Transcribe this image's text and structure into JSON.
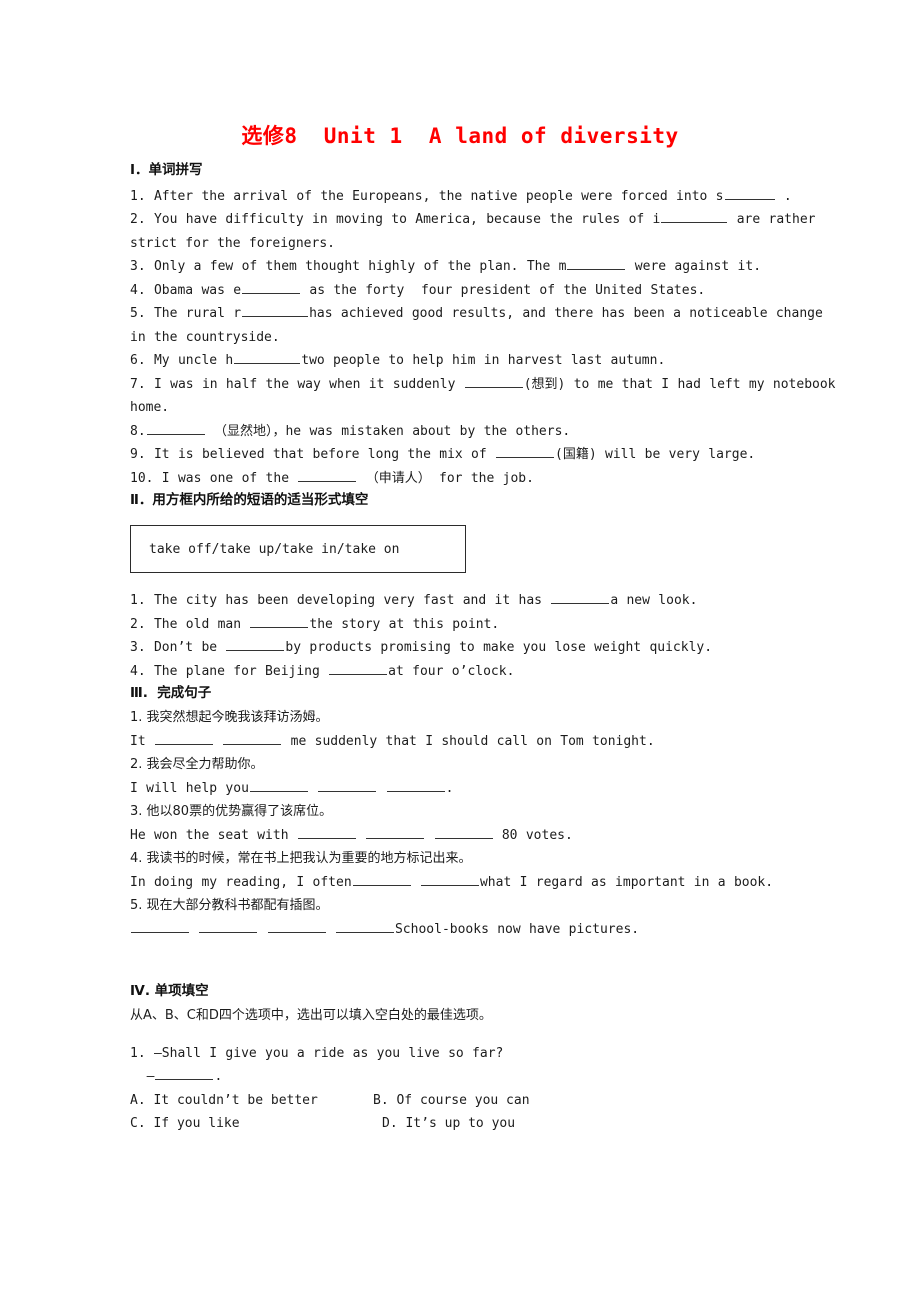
{
  "title": "选修8  Unit 1  A land of diversity",
  "sections": {
    "one": {
      "heading": "Ⅰ．单词拼写",
      "items": [
        {
          "pre": "1. After the arrival of the Europeans, the native people were forced into s",
          "blank": "b-sm",
          "post": " ."
        },
        {
          "pre": "2. You have difficulty in moving to America, because the rules of i",
          "blank": "b-lg",
          "post": " are rather"
        },
        {
          "cont": "strict for the foreigners."
        },
        {
          "pre": "3. Only a few of them thought highly of the plan. The m",
          "blank": "b-md",
          "post": " were against it."
        },
        {
          "pre": "4. Obama was e",
          "blank": "b-md",
          "post": " as the forty  four president of the United States."
        },
        {
          "pre": "5. The rural r",
          "blank": "b-lg",
          "post": "has achieved good results, and there has been a noticeable change"
        },
        {
          "cont": "in the countryside."
        },
        {
          "pre": "6. My uncle h",
          "blank": "b-lg",
          "post": "two people to help him in harvest last autumn."
        },
        {
          "pre": "7. I was in half the way when it suddenly ",
          "blank": "b-md",
          "post": "(想到) to me that I had left my notebook"
        },
        {
          "cont": "home."
        },
        {
          "pre": "8.",
          "blank": "b-md",
          "post": " （显然地），he was mistaken about by the others."
        },
        {
          "pre": "9. It is believed that before long the mix of ",
          "blank": "b-md",
          "post": "(国籍) will be very large."
        },
        {
          "pre": "10. I was one of the ",
          "blank": "b-md",
          "post": " （申请人） for the job."
        }
      ]
    },
    "two": {
      "heading": "Ⅱ．用方框内所给的短语的适当形式填空",
      "box": "take off/take up/take in/take on",
      "items": [
        {
          "pre": "1. The city has been developing very fast and it has ",
          "blank": "b-md",
          "post": "a new look."
        },
        {
          "pre": "2. The old man ",
          "blank": "b-md",
          "post": "the story at this point."
        },
        {
          "pre": "3. Don’t be ",
          "blank": "b-md",
          "post": "by products promising to make you lose weight quickly."
        },
        {
          "pre": "4. The plane for Beijing ",
          "blank": "b-md",
          "post": "at four o’clock."
        }
      ]
    },
    "three": {
      "heading": "Ⅲ.  完成句子",
      "items": [
        {
          "cn": "1. 我突然想起今晚我该拜访汤姆。"
        },
        {
          "pre": "It ",
          "blanks": 2,
          "blank": "b-md",
          "post": " me suddenly that I should call on Tom tonight."
        },
        {
          "cn": "2. 我会尽全力帮助你。"
        },
        {
          "pre": "I will help you",
          "blanks": 3,
          "blank": "b-md",
          "post": "."
        },
        {
          "cn": "3. 他以80票的优势赢得了该席位。"
        },
        {
          "pre": "He won the seat with ",
          "blanks": 3,
          "blank": "b-md",
          "post": " 80 votes."
        },
        {
          "cn": "4. 我读书的时候，常在书上把我认为重要的地方标记出来。"
        },
        {
          "pre": "In doing my reading, I often",
          "blanks": 2,
          "blank": "b-md",
          "post": "what I regard as important in a book."
        },
        {
          "cn": "5. 现在大部分教科书都配有插图。"
        },
        {
          "pre": "",
          "blanks": 4,
          "blank": "b-md",
          "post": "School-books now have pictures."
        }
      ]
    },
    "four": {
      "heading": "Ⅳ. 单项填空",
      "instruction": "从A、B、C和D四个选项中，选出可以填入空白处的最佳选项。",
      "question_stem": "1. —Shall I give you a ride as you live so far?",
      "question_answer_pre": "  —",
      "question_answer_post": ".",
      "options": {
        "a": "A. It couldn’t be better",
        "b": "B. Of course you can",
        "c": "C. If you like",
        "d": "D. It’s up to you"
      }
    }
  },
  "colors": {
    "title": "#ff0000",
    "text": "#1c1c1c",
    "rule": "#333333",
    "box_border": "#2b2b2b",
    "background": "#ffffff"
  }
}
